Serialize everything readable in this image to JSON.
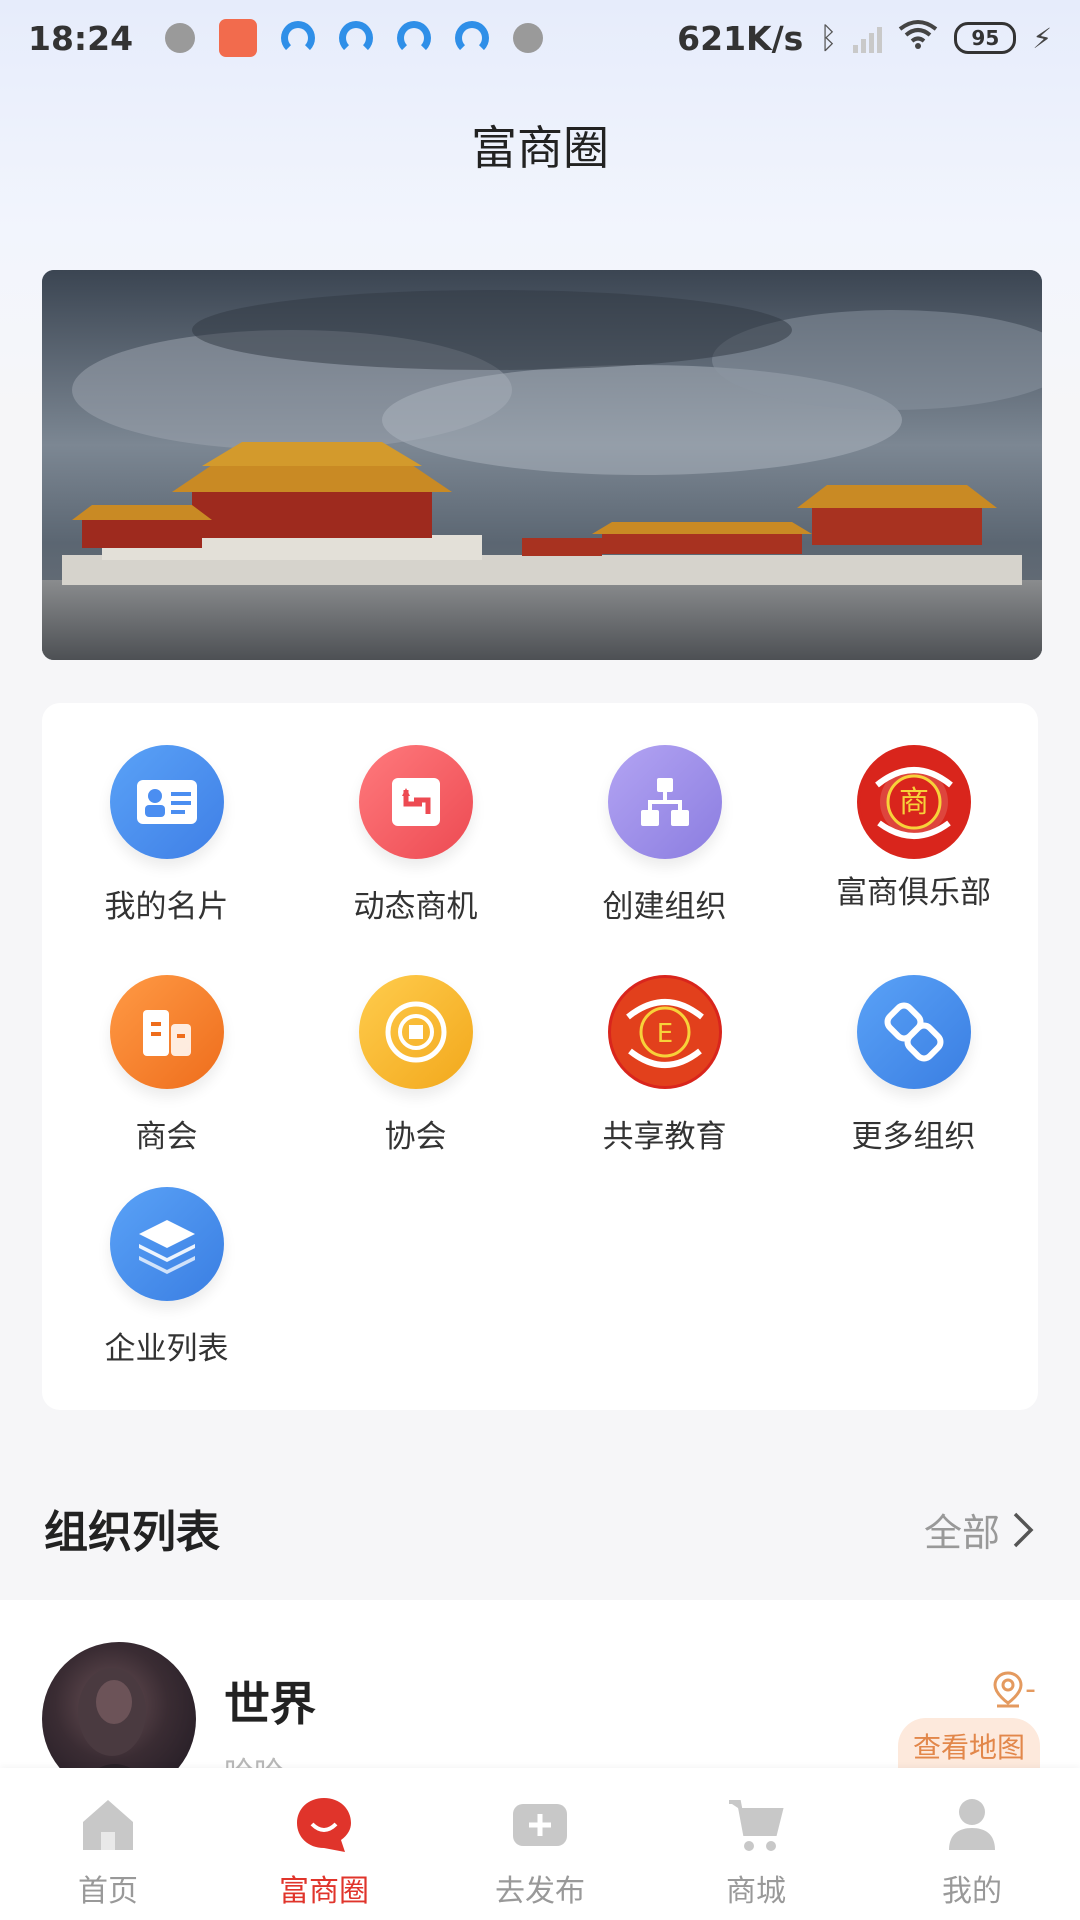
{
  "status_bar": {
    "time": "18:24",
    "network_speed": "621K/s",
    "battery": "95"
  },
  "header": {
    "title": "富商圈"
  },
  "banner": {
    "image": "forbidden-city-palace-photo"
  },
  "grid": [
    {
      "label": "我的名片",
      "icon": "business-card-icon",
      "color": "#4b8ef1"
    },
    {
      "label": "动态商机",
      "icon": "dynamic-opportunity-icon",
      "color": "#f0575c"
    },
    {
      "label": "创建组织",
      "icon": "org-chart-icon",
      "color": "#9b8ae8"
    },
    {
      "label": "富商俱乐部",
      "icon": "shang-club-logo-icon",
      "color": "#d9251c"
    },
    {
      "label": "商会",
      "icon": "building-icon",
      "color": "#f27420"
    },
    {
      "label": "协会",
      "icon": "coin-icon",
      "color": "#f4b21e"
    },
    {
      "label": "共享教育",
      "icon": "education-logo-icon",
      "color": "#d9251c"
    },
    {
      "label": "更多组织",
      "icon": "link-icon",
      "color": "#3f8ae8"
    },
    {
      "label": "企业列表",
      "icon": "layers-icon",
      "color": "#3f8ae8"
    }
  ],
  "section": {
    "title": "组织列表",
    "more_label": "全部"
  },
  "org_list": [
    {
      "name": "世界",
      "desc": "哈哈",
      "distance": "-",
      "map_button": "查看地图"
    }
  ],
  "tabs": [
    {
      "label": "首页",
      "icon": "home-icon",
      "active": false
    },
    {
      "label": "富商圈",
      "icon": "chat-bubble-icon",
      "active": true
    },
    {
      "label": "去发布",
      "icon": "publish-plus-icon",
      "active": false
    },
    {
      "label": "商城",
      "icon": "shopping-cart-icon",
      "active": false
    },
    {
      "label": "我的",
      "icon": "user-icon",
      "active": false
    }
  ],
  "colors": {
    "accent": "#e0342b",
    "tab_inactive": "#999999",
    "map_button_text": "#e2874a"
  }
}
